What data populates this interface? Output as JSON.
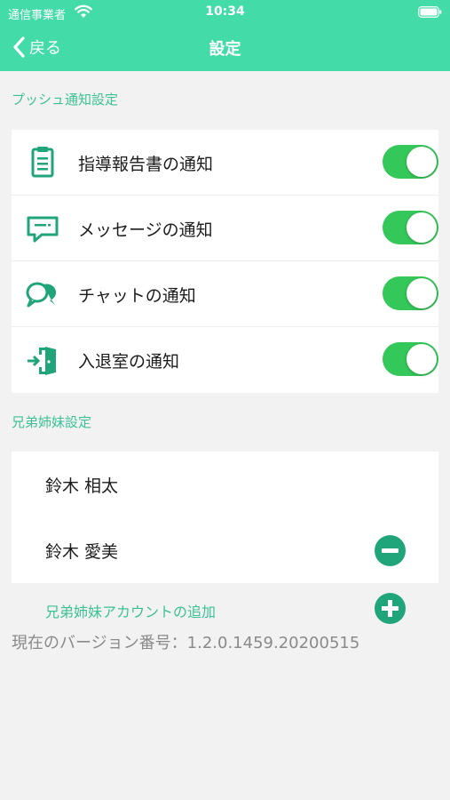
{
  "status_bar": {
    "carrier": "通信事業者",
    "time": "10:34"
  },
  "nav": {
    "back_label": "戻る",
    "title": "設定"
  },
  "push_section": {
    "header": "プッシュ通知設定",
    "items": [
      {
        "label": "指導報告書の通知",
        "icon": "clipboard-icon",
        "enabled": true
      },
      {
        "label": "メッセージの通知",
        "icon": "message-icon",
        "enabled": true
      },
      {
        "label": "チャットの通知",
        "icon": "chat-bubbles-icon",
        "enabled": true
      },
      {
        "label": "入退室の通知",
        "icon": "door-entry-icon",
        "enabled": true
      }
    ]
  },
  "siblings_section": {
    "header": "兄弟姉妹設定",
    "members": [
      {
        "name": "鈴木 相太",
        "removable": false
      },
      {
        "name": "鈴木 愛美",
        "removable": true
      }
    ],
    "add_label": "兄弟姉妹アカウントの追加"
  },
  "version_text": "現在のバージョン番号：1.2.0.1459.20200515",
  "colors": {
    "header": "#43dba8",
    "section_text": "#3cc196",
    "toggle_on": "#34c759",
    "icon_green": "#20a57b",
    "page_bg": "#f2f2f2"
  }
}
